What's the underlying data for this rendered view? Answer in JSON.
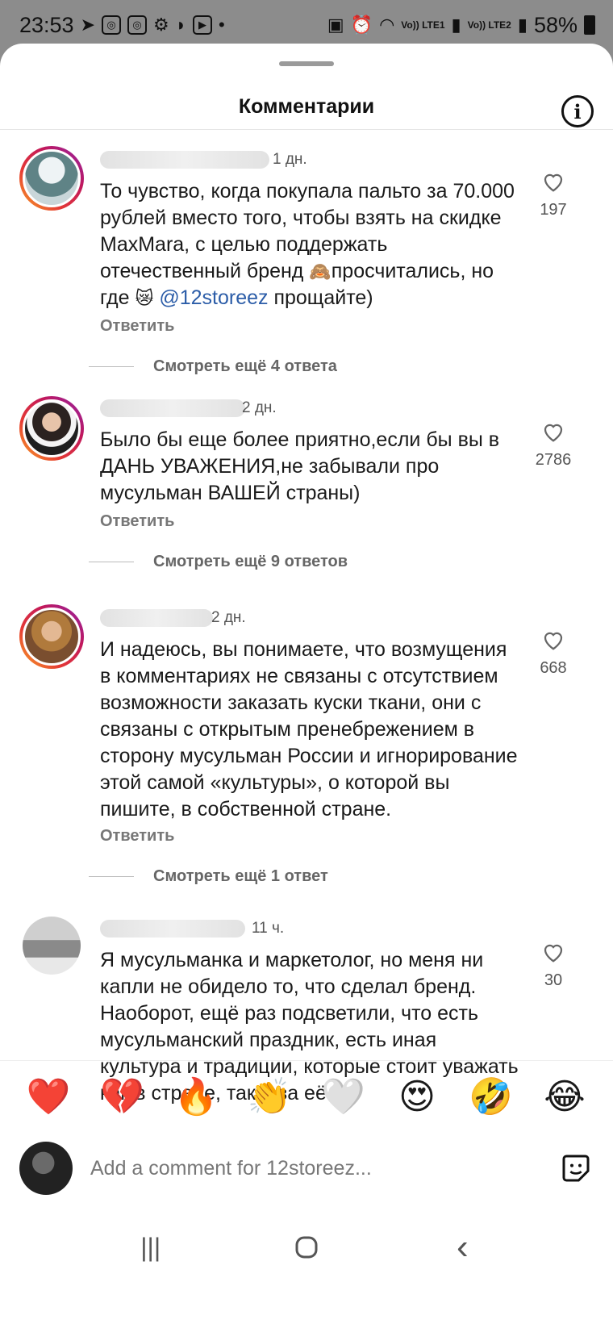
{
  "status_bar": {
    "time": "23:53",
    "left_icons": [
      "telegram-icon",
      "instagram-icon",
      "instagram-icon",
      "settings-icon",
      "media-icon",
      "yt-icon"
    ],
    "signal_labels": [
      "Vo)) LTE1",
      "Vo)) LTE2"
    ],
    "battery": "58%"
  },
  "header": {
    "title": "Комментарии"
  },
  "comments": [
    {
      "time": "1 дн.",
      "text_before": "То чувство, когда покупала пальто за 70.000 рублей вместо того, чтобы взять на скидке MaxMara, с целью поддержать отечественный бренд ",
      "emoji1": "🙈",
      "text_mid": "просчитались, но где ",
      "emoji2": "😿",
      "mention": "@12storeez",
      "text_after": " прощайте)",
      "likes": "197",
      "reply_label": "Ответить",
      "more_replies": "Смотреть ещё 4 ответа"
    },
    {
      "time": "2 дн.",
      "text": "Было бы еще более приятно,если бы вы в ДАНЬ УВАЖЕНИЯ,не забывали про мусульман ВАШЕЙ страны)",
      "likes": "2786",
      "reply_label": "Ответить",
      "more_replies": "Смотреть ещё 9 ответов"
    },
    {
      "time": "2 дн.",
      "text": "И надеюсь, вы понимаете, что возмущения в комментариях не связаны с отсутствием возможности заказать куски ткани, они с связаны с открытым пренебрежением в сторону мусульман России и игнорирование этой самой «культуры», о которой вы пишите, в собственной стране.",
      "likes": "668",
      "reply_label": "Ответить",
      "more_replies": "Смотреть ещё 1 ответ"
    },
    {
      "time": "11 ч.",
      "text": "Я мусульманка и маркетолог, но меня ни капли не обидело то, что сделал бренд. Наоборот, ещё раз подсветили, что есть мусульманский праздник, есть иная культура и традиции, которые стоит уважать как в стране, так и за её",
      "likes": "30"
    }
  ],
  "reactions": [
    "❤️",
    "💔",
    "🔥",
    "👏",
    "🤍",
    "😍",
    "🤣",
    "😂"
  ],
  "composer": {
    "placeholder": "Add a comment for 12storeez..."
  },
  "nav": {
    "recents": "|||",
    "home": "○",
    "back": "‹"
  }
}
